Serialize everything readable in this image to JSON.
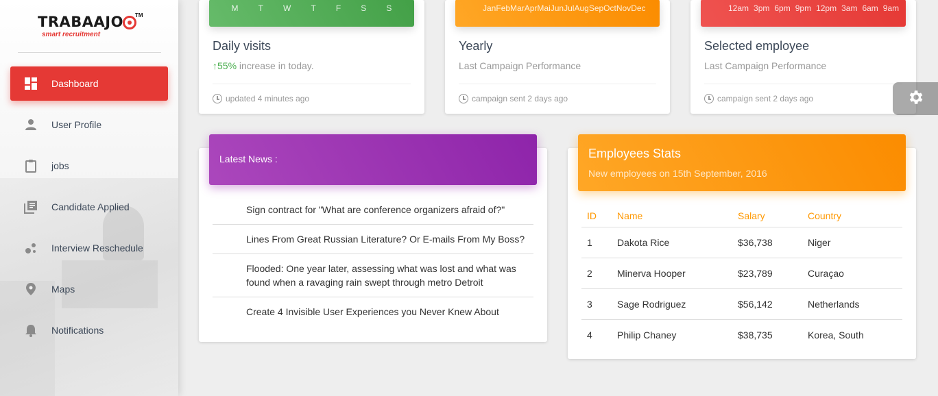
{
  "brand": {
    "name": "TRABAAJO",
    "tm": "TM",
    "tagline": "smart recruitment",
    "color": "#e53935"
  },
  "sidebar": {
    "items": [
      {
        "label": "Dashboard",
        "icon": "dashboard-icon",
        "active": true
      },
      {
        "label": "User Profile",
        "icon": "person-icon"
      },
      {
        "label": "jobs",
        "icon": "clipboard-icon"
      },
      {
        "label": "Candidate Applied",
        "icon": "library-books-icon"
      },
      {
        "label": "Interview Reschedule",
        "icon": "bubble-chart-icon"
      },
      {
        "label": "Maps",
        "icon": "location-pin-icon"
      },
      {
        "label": "Notifications",
        "icon": "bell-icon"
      }
    ]
  },
  "cards": [
    {
      "chart_labels": [
        "M",
        "T",
        "W",
        "T",
        "F",
        "S",
        "S"
      ],
      "chart_color": "#4caf50",
      "title": "Daily visits",
      "category_highlight": "55%",
      "category_rest": " increase in today.",
      "footer": "updated 4 minutes ago"
    },
    {
      "chart_labels": [
        "Jan",
        "Feb",
        "Mar",
        "Apr",
        "Mai",
        "Jun",
        "Jul",
        "Aug",
        "Sep",
        "Oct",
        "Nov",
        "Dec"
      ],
      "chart_color": "#ff9800",
      "title": "Yearly",
      "category": "Last Campaign Performance",
      "footer": "campaign sent 2 days ago"
    },
    {
      "chart_labels": [
        "12am",
        "3pm",
        "6pm",
        "9pm",
        "12pm",
        "3am",
        "6am",
        "9am"
      ],
      "chart_color": "#f44336",
      "title": "Selected employee",
      "category": "Last Campaign Performance",
      "footer": "campaign sent 2 days ago"
    }
  ],
  "news": {
    "title": "Latest News :",
    "items": [
      "Sign contract for \"What are conference organizers afraid of?\"",
      "Lines From Great Russian Literature? Or E-mails From My Boss?",
      "Flooded: One year later, assessing what was lost and what was found when a ravaging rain swept through metro Detroit",
      "Create 4 Invisible User Experiences you Never Knew About"
    ]
  },
  "employees": {
    "title": "Employees Stats",
    "subtitle": "New employees on 15th September, 2016",
    "columns": [
      "ID",
      "Name",
      "Salary",
      "Country"
    ],
    "rows": [
      [
        "1",
        "Dakota Rice",
        "$36,738",
        "Niger"
      ],
      [
        "2",
        "Minerva Hooper",
        "$23,789",
        "Curaçao"
      ],
      [
        "3",
        "Sage Rodriguez",
        "$56,142",
        "Netherlands"
      ],
      [
        "4",
        "Philip Chaney",
        "$38,735",
        "Korea, South"
      ]
    ]
  },
  "settings": {
    "icon": "gear-icon"
  }
}
